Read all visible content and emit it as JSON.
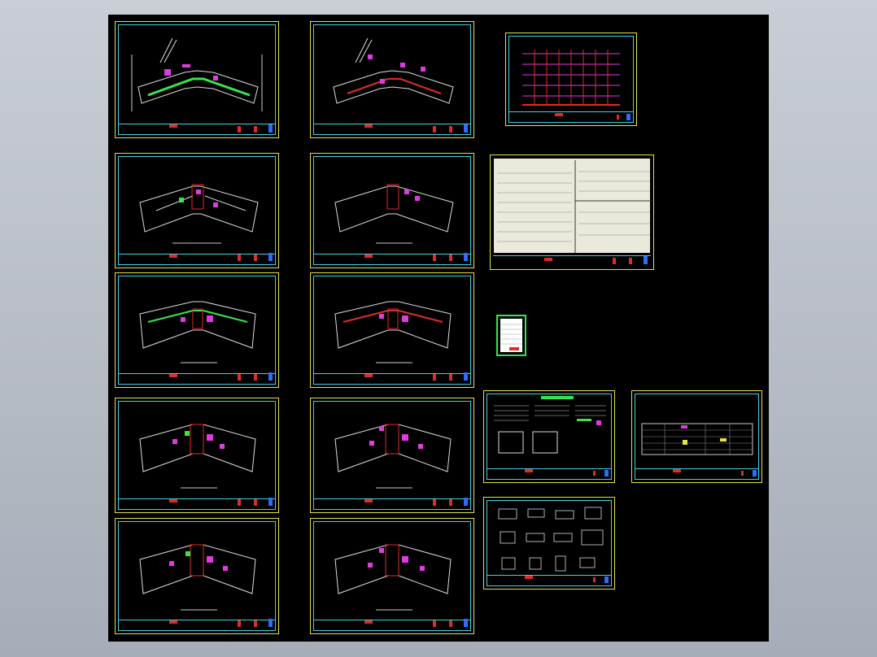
{
  "app": {
    "view": "cad-layout-preview",
    "background_color": "#000000",
    "frame_colors": {
      "outer": "#e6e14a",
      "inner": "#3fd3e0",
      "accent_green": "#36e64b",
      "accent_magenta": "#e13be0",
      "accent_red": "#e22a2a"
    }
  },
  "sheets": [
    {
      "id": "floor-plan-1",
      "kind": "floor-plan"
    },
    {
      "id": "floor-plan-2",
      "kind": "floor-plan"
    },
    {
      "id": "riser-diagram",
      "kind": "riser-diagram"
    },
    {
      "id": "floor-plan-3",
      "kind": "floor-plan"
    },
    {
      "id": "floor-plan-4",
      "kind": "floor-plan"
    },
    {
      "id": "equipment-schedule",
      "kind": "table-sheet"
    },
    {
      "id": "floor-plan-5",
      "kind": "floor-plan"
    },
    {
      "id": "floor-plan-6",
      "kind": "floor-plan"
    },
    {
      "id": "legend-card",
      "kind": "legend"
    },
    {
      "id": "floor-plan-7",
      "kind": "floor-plan"
    },
    {
      "id": "floor-plan-8",
      "kind": "floor-plan"
    },
    {
      "id": "design-notes",
      "kind": "notes-sheet"
    },
    {
      "id": "symbol-table",
      "kind": "table-sheet"
    },
    {
      "id": "floor-plan-9",
      "kind": "floor-plan"
    },
    {
      "id": "floor-plan-10",
      "kind": "floor-plan"
    },
    {
      "id": "detail-drawings",
      "kind": "details-sheet"
    }
  ]
}
